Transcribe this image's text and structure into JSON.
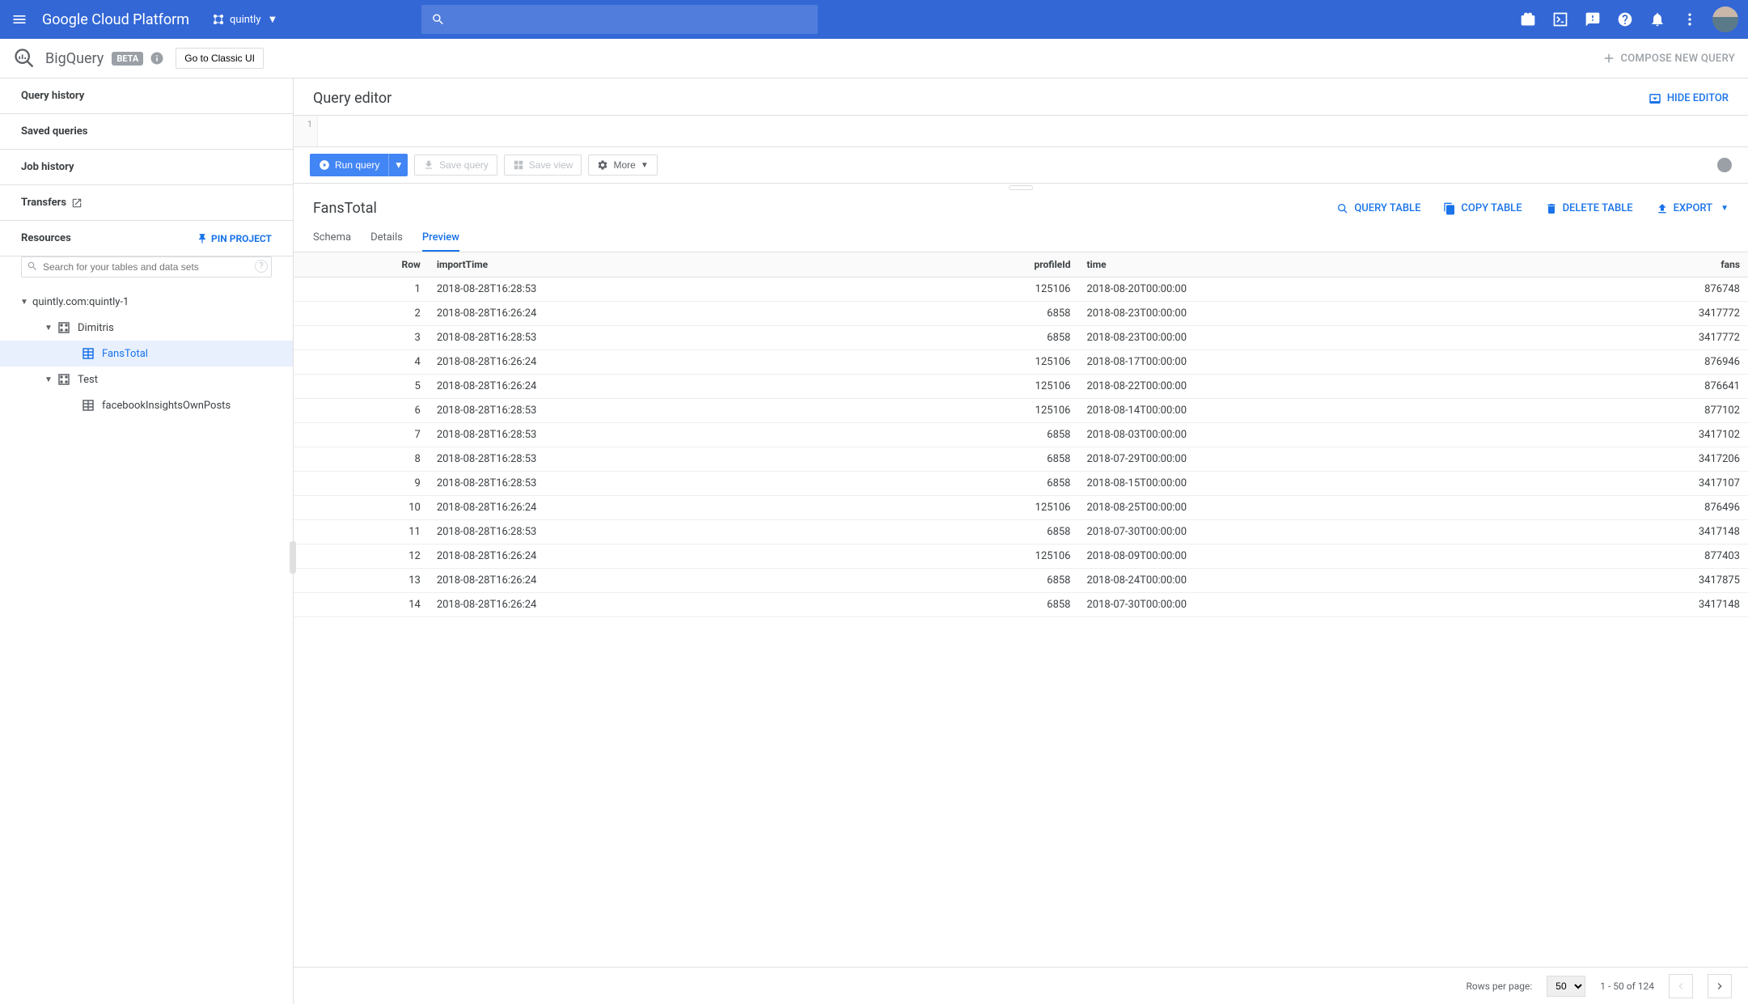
{
  "header": {
    "logo": "Google Cloud Platform",
    "project": "quintly"
  },
  "subheader": {
    "title": "BigQuery",
    "beta": "BETA",
    "classic": "Go to Classic UI",
    "compose": "COMPOSE NEW QUERY"
  },
  "sidebar": {
    "links": {
      "query_history": "Query history",
      "saved_queries": "Saved queries",
      "job_history": "Job history",
      "transfers": "Transfers",
      "resources": "Resources",
      "pin": "PIN PROJECT"
    },
    "search_placeholder": "Search for your tables and data sets",
    "tree": {
      "project": "quintly.com:quintly-1",
      "ds1": "Dimitris",
      "ds1_t1": "FansTotal",
      "ds2": "Test",
      "ds2_t1": "facebookInsightsOwnPosts"
    }
  },
  "editor": {
    "title": "Query editor",
    "hide": "HIDE EDITOR",
    "line": "1",
    "run": "Run query",
    "save_query": "Save query",
    "save_view": "Save view",
    "more": "More"
  },
  "table": {
    "title": "FansTotal",
    "actions": {
      "query": "QUERY TABLE",
      "copy": "COPY TABLE",
      "delete": "DELETE TABLE",
      "export": "EXPORT"
    },
    "tabs": {
      "schema": "Schema",
      "details": "Details",
      "preview": "Preview"
    },
    "columns": [
      "Row",
      "importTime",
      "profileId",
      "time",
      "fans"
    ],
    "rows": [
      [
        1,
        "2018-08-28T16:28:53",
        125106,
        "2018-08-20T00:00:00",
        876748
      ],
      [
        2,
        "2018-08-28T16:26:24",
        6858,
        "2018-08-23T00:00:00",
        3417772
      ],
      [
        3,
        "2018-08-28T16:28:53",
        6858,
        "2018-08-23T00:00:00",
        3417772
      ],
      [
        4,
        "2018-08-28T16:26:24",
        125106,
        "2018-08-17T00:00:00",
        876946
      ],
      [
        5,
        "2018-08-28T16:26:24",
        125106,
        "2018-08-22T00:00:00",
        876641
      ],
      [
        6,
        "2018-08-28T16:28:53",
        125106,
        "2018-08-14T00:00:00",
        877102
      ],
      [
        7,
        "2018-08-28T16:28:53",
        6858,
        "2018-08-03T00:00:00",
        3417102
      ],
      [
        8,
        "2018-08-28T16:28:53",
        6858,
        "2018-07-29T00:00:00",
        3417206
      ],
      [
        9,
        "2018-08-28T16:28:53",
        6858,
        "2018-08-15T00:00:00",
        3417107
      ],
      [
        10,
        "2018-08-28T16:26:24",
        125106,
        "2018-08-25T00:00:00",
        876496
      ],
      [
        11,
        "2018-08-28T16:28:53",
        6858,
        "2018-07-30T00:00:00",
        3417148
      ],
      [
        12,
        "2018-08-28T16:26:24",
        125106,
        "2018-08-09T00:00:00",
        877403
      ],
      [
        13,
        "2018-08-28T16:26:24",
        6858,
        "2018-08-24T00:00:00",
        3417875
      ],
      [
        14,
        "2018-08-28T16:26:24",
        6858,
        "2018-07-30T00:00:00",
        3417148
      ]
    ]
  },
  "footer": {
    "rpp_label": "Rows per page:",
    "rpp_value": "50",
    "range": "1 - 50 of 124"
  }
}
